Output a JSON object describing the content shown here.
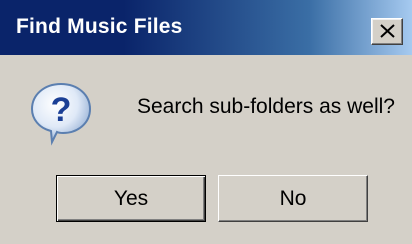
{
  "dialog": {
    "title": "Find Music Files",
    "message": "Search sub-folders as well?",
    "icon": "question-icon",
    "buttons": {
      "yes_label": "Yes",
      "no_label": "No"
    },
    "close_icon": "close-icon"
  },
  "colors": {
    "titlebar_start": "#0a246a",
    "titlebar_end": "#a6caf0",
    "dialog_bg": "#d4d0c8"
  }
}
